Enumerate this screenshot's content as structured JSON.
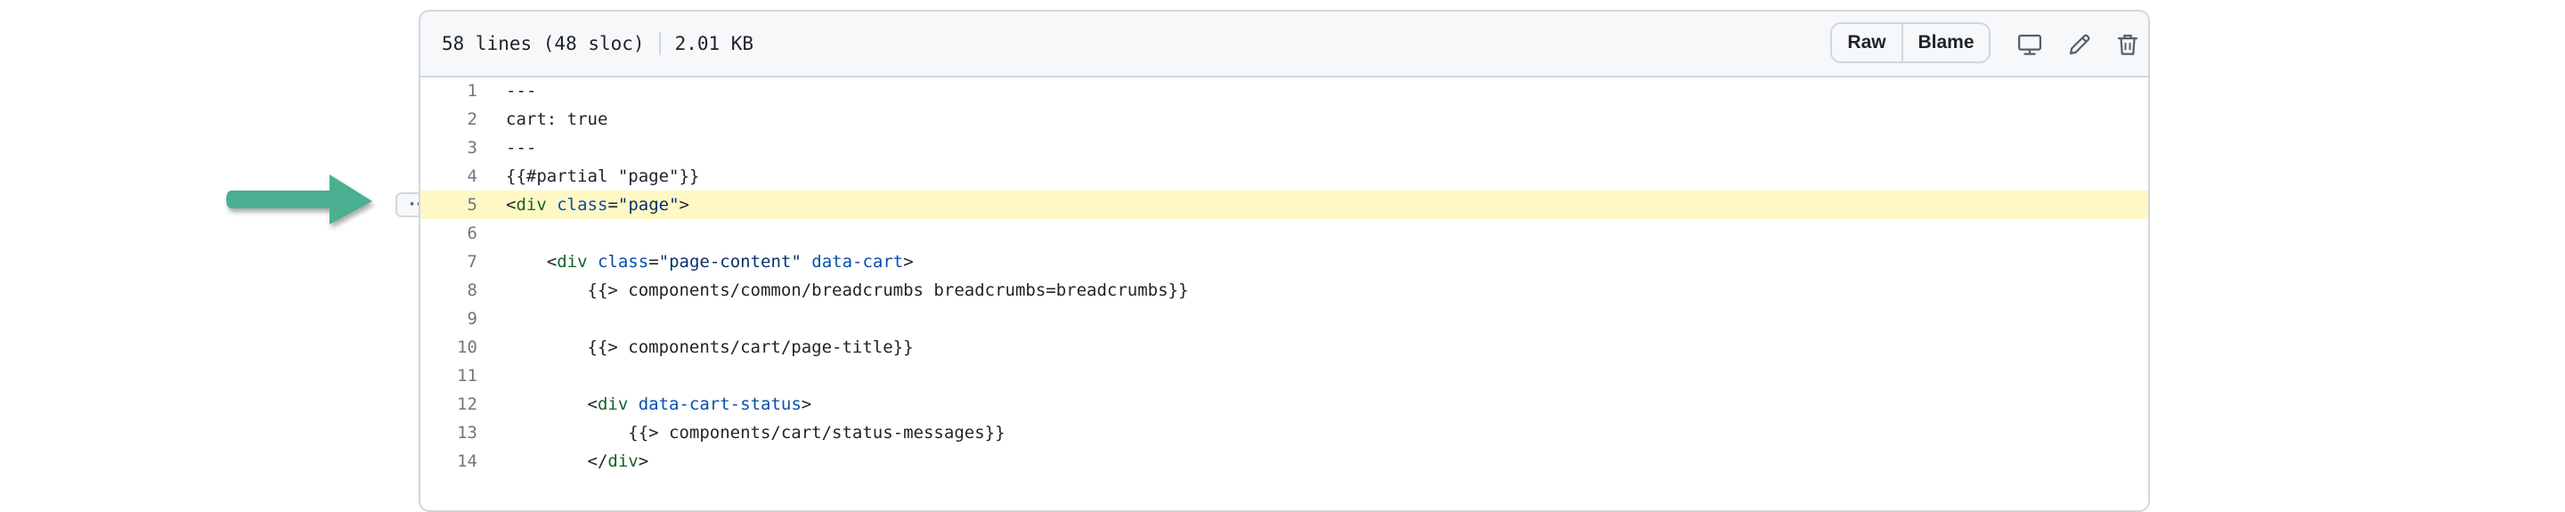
{
  "header": {
    "lines_info": "58 lines (48 sloc)",
    "file_size": "2.01 KB",
    "raw_label": "Raw",
    "blame_label": "Blame",
    "icons": [
      "display-icon",
      "pencil-icon",
      "trash-icon"
    ]
  },
  "line_menu": {
    "label": "···"
  },
  "annotation": {
    "color": "#4caf92"
  },
  "colors": {
    "highlight": "#fff8c5",
    "tag": "#116329",
    "attr": "#0550ae",
    "string": "#0a3069"
  },
  "code": {
    "highlighted_line": 5,
    "lines": [
      {
        "n": "1",
        "tokens": [
          {
            "t": "---",
            "c": ""
          }
        ]
      },
      {
        "n": "2",
        "tokens": [
          {
            "t": "cart: true",
            "c": ""
          }
        ]
      },
      {
        "n": "3",
        "tokens": [
          {
            "t": "---",
            "c": ""
          }
        ]
      },
      {
        "n": "4",
        "tokens": [
          {
            "t": "{{#partial \"page\"}}",
            "c": ""
          }
        ]
      },
      {
        "n": "5",
        "tokens": [
          {
            "t": "<",
            "c": ""
          },
          {
            "t": "div",
            "c": "tg"
          },
          {
            "t": " ",
            "c": ""
          },
          {
            "t": "class",
            "c": "at"
          },
          {
            "t": "=",
            "c": ""
          },
          {
            "t": "\"page\"",
            "c": "st"
          },
          {
            "t": ">",
            "c": ""
          }
        ]
      },
      {
        "n": "6",
        "tokens": [
          {
            "t": "",
            "c": ""
          }
        ]
      },
      {
        "n": "7",
        "tokens": [
          {
            "t": "    <",
            "c": ""
          },
          {
            "t": "div",
            "c": "tg"
          },
          {
            "t": " ",
            "c": ""
          },
          {
            "t": "class",
            "c": "at"
          },
          {
            "t": "=",
            "c": ""
          },
          {
            "t": "\"page-content\"",
            "c": "st"
          },
          {
            "t": " ",
            "c": ""
          },
          {
            "t": "data-cart",
            "c": "at"
          },
          {
            "t": ">",
            "c": ""
          }
        ]
      },
      {
        "n": "8",
        "tokens": [
          {
            "t": "        {{> components/common/breadcrumbs breadcrumbs=breadcrumbs}}",
            "c": ""
          }
        ]
      },
      {
        "n": "9",
        "tokens": [
          {
            "t": "",
            "c": ""
          }
        ]
      },
      {
        "n": "10",
        "tokens": [
          {
            "t": "        {{> components/cart/page-title}}",
            "c": ""
          }
        ]
      },
      {
        "n": "11",
        "tokens": [
          {
            "t": "",
            "c": ""
          }
        ]
      },
      {
        "n": "12",
        "tokens": [
          {
            "t": "        <",
            "c": ""
          },
          {
            "t": "div",
            "c": "tg"
          },
          {
            "t": " ",
            "c": ""
          },
          {
            "t": "data-cart-status",
            "c": "at"
          },
          {
            "t": ">",
            "c": ""
          }
        ]
      },
      {
        "n": "13",
        "tokens": [
          {
            "t": "            {{> components/cart/status-messages}}",
            "c": ""
          }
        ]
      },
      {
        "n": "14",
        "tokens": [
          {
            "t": "        </",
            "c": ""
          },
          {
            "t": "div",
            "c": "tg"
          },
          {
            "t": ">",
            "c": ""
          }
        ]
      }
    ]
  }
}
